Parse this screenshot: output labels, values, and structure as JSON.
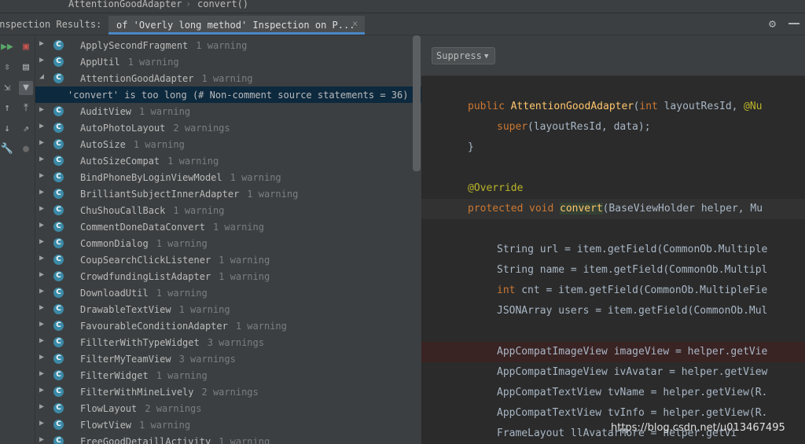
{
  "breadcrumb": {
    "items": [
      "AttentionGoodAdapter",
      "convert()"
    ],
    "separator": "›"
  },
  "toolwindow": {
    "title": "Inspection Results:",
    "tab_label": "of 'Overly long method' Inspection on P...",
    "tab_close": "×"
  },
  "tree": {
    "items": [
      {
        "name": "ApplySecondFragment",
        "count": "1 warning",
        "expanded": false
      },
      {
        "name": "AppUtil",
        "count": "1 warning",
        "expanded": false
      },
      {
        "name": "AttentionGoodAdapter",
        "count": "1 warning",
        "expanded": true
      },
      {
        "name": "AuditView",
        "count": "1 warning",
        "expanded": false
      },
      {
        "name": "AutoPhotoLayout",
        "count": "2 warnings",
        "expanded": false
      },
      {
        "name": "AutoSize",
        "count": "1 warning",
        "expanded": false
      },
      {
        "name": "AutoSizeCompat",
        "count": "1 warning",
        "expanded": false
      },
      {
        "name": "BindPhoneByLoginViewModel",
        "count": "1 warning",
        "expanded": false
      },
      {
        "name": "BrilliantSubjectInnerAdapter",
        "count": "1 warning",
        "expanded": false
      },
      {
        "name": "ChuShouCallBack",
        "count": "1 warning",
        "expanded": false
      },
      {
        "name": "CommentDoneDataConvert",
        "count": "1 warning",
        "expanded": false
      },
      {
        "name": "CommonDialog",
        "count": "1 warning",
        "expanded": false
      },
      {
        "name": "CoupSearchClickListener",
        "count": "1 warning",
        "expanded": false
      },
      {
        "name": "CrowdfundingListAdapter",
        "count": "1 warning",
        "expanded": false
      },
      {
        "name": "DownloadUtil",
        "count": "1 warning",
        "expanded": false
      },
      {
        "name": "DrawableTextView",
        "count": "1 warning",
        "expanded": false
      },
      {
        "name": "FavourableConditionAdapter",
        "count": "1 warning",
        "expanded": false
      },
      {
        "name": "FillterWithTypeWidget",
        "count": "3 warnings",
        "expanded": false
      },
      {
        "name": "FilterMyTeamView",
        "count": "3 warnings",
        "expanded": false
      },
      {
        "name": "FilterWidget",
        "count": "1 warning",
        "expanded": false
      },
      {
        "name": "FilterWithMineLively",
        "count": "2 warnings",
        "expanded": false
      },
      {
        "name": "FlowLayout",
        "count": "2 warnings",
        "expanded": false
      },
      {
        "name": "FlowtView",
        "count": "1 warning",
        "expanded": false
      },
      {
        "name": "FreeGoodDetaillActivity",
        "count": "1 warning",
        "expanded": false
      }
    ],
    "problem": "'convert' is too long (# Non-comment source statements = 36)",
    "icon_letter": "C",
    "colors": {
      "class_icon": "#3b8aa7",
      "selection": "#0d293e"
    }
  },
  "editor": {
    "suppress_label": "Suppress",
    "lines": [
      {
        "text": ""
      },
      {
        "indent": 0,
        "parts": [
          [
            "public ",
            "kw"
          ],
          [
            "AttentionGoodAdapter",
            "cls"
          ],
          [
            "(",
            "txt"
          ],
          [
            "int ",
            "kw"
          ],
          [
            "layoutResId, ",
            "txt"
          ],
          [
            "@Nu",
            "ann"
          ]
        ]
      },
      {
        "indent": 1,
        "parts": [
          [
            "super",
            "kw"
          ],
          [
            "(layoutResId, data);",
            "txt"
          ]
        ]
      },
      {
        "indent": 0,
        "parts": [
          [
            "}",
            "txt"
          ]
        ]
      },
      {
        "text": ""
      },
      {
        "indent": 0,
        "parts": [
          [
            "@Override",
            "ann"
          ]
        ]
      },
      {
        "indent": 0,
        "style": "current",
        "parts": [
          [
            "protected ",
            "kw"
          ],
          [
            "void ",
            "kw"
          ],
          [
            "convert",
            "hl"
          ],
          [
            "(BaseViewHolder helper, Mu",
            "txt"
          ]
        ]
      },
      {
        "text": ""
      },
      {
        "indent": 1,
        "parts": [
          [
            "String url = item.getField(CommonOb.Multiple",
            "txt"
          ]
        ]
      },
      {
        "indent": 1,
        "parts": [
          [
            "String name = item.getField(CommonOb.Multipl",
            "txt"
          ]
        ]
      },
      {
        "indent": 1,
        "parts": [
          [
            "int ",
            "kw"
          ],
          [
            "cnt = item.getField(CommonOb.MultipleFie",
            "txt"
          ]
        ]
      },
      {
        "indent": 1,
        "parts": [
          [
            "JSONArray users = item.getField(CommonOb.Mul",
            "txt"
          ]
        ]
      },
      {
        "text": ""
      },
      {
        "indent": 1,
        "style": "error",
        "parts": [
          [
            "AppCompatImageView imageView = helper.getVie",
            "txt"
          ]
        ]
      },
      {
        "indent": 1,
        "parts": [
          [
            "AppCompatImageView ivAvatar = helper.getView",
            "txt"
          ]
        ]
      },
      {
        "indent": 1,
        "parts": [
          [
            "AppCompatTextView tvName = helper.getView(R.",
            "txt"
          ]
        ]
      },
      {
        "indent": 1,
        "parts": [
          [
            "AppCompatTextView tvInfo = helper.getView(R.",
            "txt"
          ]
        ]
      },
      {
        "indent": 1,
        "parts": [
          [
            "FrameLayout llAvatarMore = helper.getVi",
            "txt"
          ]
        ]
      }
    ]
  },
  "watermark": "https://blog.csdn.net/u013467495"
}
